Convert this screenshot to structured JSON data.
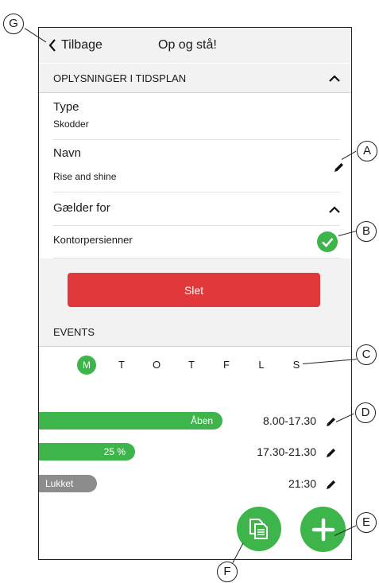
{
  "header": {
    "back_label": "Tilbage",
    "title": "Op og stå!"
  },
  "schedule_section": {
    "label": "OPLYSNINGER I TIDSPLAN"
  },
  "fields": {
    "type": {
      "label": "Type",
      "value": "Skodder"
    },
    "name": {
      "label": "Navn",
      "value": "Rise and shine"
    },
    "applies": {
      "label": "Gælder for",
      "item": "Kontorpersienner"
    }
  },
  "delete_label": "Slet",
  "events_section": {
    "label": "EVENTS"
  },
  "days": [
    "M",
    "T",
    "O",
    "T",
    "F",
    "L",
    "S"
  ],
  "selected_day": "M",
  "events": [
    {
      "label": "Åben",
      "time": "8.00-17.30",
      "color": "#3db54a"
    },
    {
      "label": "25 %",
      "time": "17.30-21.30",
      "color": "#3db54a"
    },
    {
      "label": "Lukket",
      "time": "21:30",
      "color": "#8c8c8c"
    }
  ],
  "callouts": {
    "a": "A",
    "b": "B",
    "c": "C",
    "d": "D",
    "e": "E",
    "f": "F",
    "g": "G"
  },
  "colors": {
    "accent": "#3db54a",
    "danger": "#e0383b",
    "section_bg": "#f2f2f2"
  },
  "icons": {
    "back": "chevron-left-icon",
    "collapse": "chevron-up-icon",
    "edit": "pencil-icon",
    "check": "check-circle-icon",
    "copy": "copy-icon",
    "add": "plus-icon"
  }
}
